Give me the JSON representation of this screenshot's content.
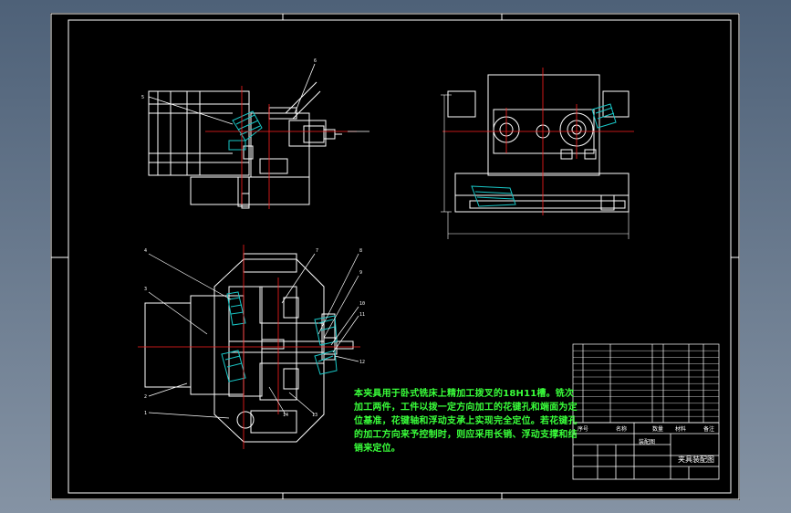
{
  "drawing": {
    "note_text": "本夹具用于卧式铣床上精加工拨叉的18H11槽。铣次加工两件，工件以拨一定方向加工的花键孔和端面为定位基准，花键轴和浮动支承上实现完全定位。若花键孔的加工方向来予控制时，则应采用长销、浮动支撑和结销来定位。",
    "title_block": {
      "drawing_name": "夹具装配图",
      "sub_title": "装配图",
      "col_headers": [
        "序号",
        "名称",
        "数量",
        "材料",
        "备注"
      ]
    },
    "balloons_side": [
      "6",
      "5"
    ],
    "balloons_plan": [
      "4",
      "3",
      "2",
      "1",
      "7",
      "8",
      "9",
      "10",
      "11",
      "12",
      "13",
      "14"
    ]
  },
  "colors": {
    "frame": "#ffffff",
    "centerline": "#ff2020",
    "hatch": "#19c8c8",
    "note": "#39ff3a",
    "background": "#000000"
  }
}
